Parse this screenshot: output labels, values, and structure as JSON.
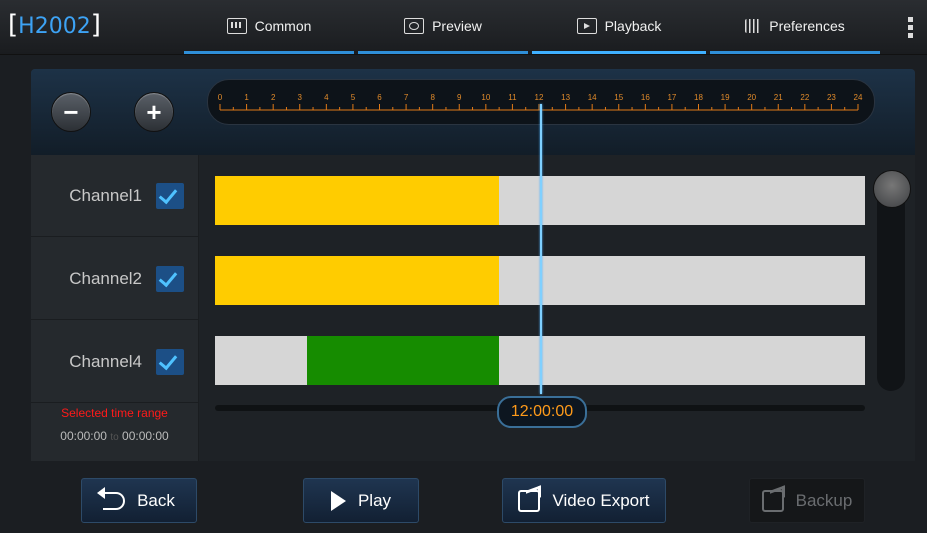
{
  "device_id": "H2002",
  "tabs": [
    {
      "label": "Common",
      "icon": "keyboard-icon"
    },
    {
      "label": "Preview",
      "icon": "camera-icon"
    },
    {
      "label": "Playback",
      "icon": "playback-icon",
      "active": true
    },
    {
      "label": "Preferences",
      "icon": "sliders-icon"
    }
  ],
  "zoom": {
    "minus": "−",
    "plus": "+"
  },
  "ruler_hours": [
    "0",
    "1",
    "2",
    "3",
    "4",
    "5",
    "6",
    "7",
    "8",
    "9",
    "10",
    "11",
    "12",
    "13",
    "14",
    "15",
    "16",
    "17",
    "18",
    "19",
    "20",
    "21",
    "22",
    "23",
    "24"
  ],
  "channels": [
    {
      "name": "Channel1",
      "checked": true,
      "segments": [
        {
          "start_hour": 0,
          "end_hour": 10.5,
          "color": "#ffcc00"
        }
      ]
    },
    {
      "name": "Channel2",
      "checked": true,
      "segments": [
        {
          "start_hour": 0,
          "end_hour": 10.5,
          "color": "#ffcc00"
        }
      ]
    },
    {
      "name": "Channel4",
      "checked": true,
      "segments": [
        {
          "start_hour": 3.4,
          "end_hour": 10.5,
          "color": "#168c00"
        }
      ]
    }
  ],
  "selected_range": {
    "label": "Selected time range",
    "from": "00:00:00",
    "to_word": "to",
    "to": "00:00:00"
  },
  "current_time": "12:00:00",
  "current_hour": 12,
  "buttons": {
    "back": "Back",
    "play": "Play",
    "video_export": "Video Export",
    "backup": "Backup"
  },
  "colors": {
    "accent": "#3fb0ff",
    "selected_label": "#ff1a1a",
    "time_badge": "#ff9b1a",
    "recording_normal": "#ffcc00",
    "recording_alt": "#168c00",
    "track_empty": "#d6d6d6"
  }
}
